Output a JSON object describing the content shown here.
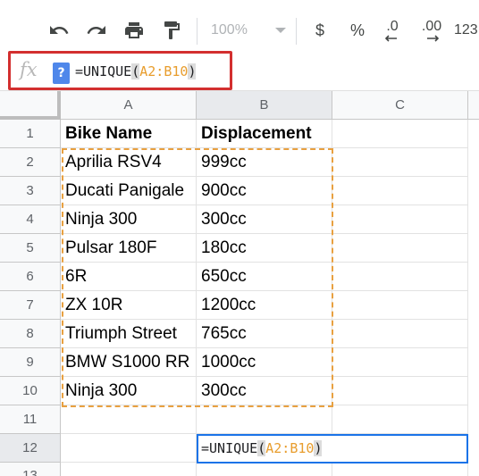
{
  "toolbar": {
    "undo_icon": "undo-icon",
    "redo_icon": "redo-icon",
    "print_icon": "print-icon",
    "paint_format_icon": "paint-format-icon",
    "zoom": "100%",
    "currency": "$",
    "percent": "%",
    "decrease_decimal": ".0",
    "increase_decimal": ".00",
    "more_formats": "123"
  },
  "formula_bar": {
    "fx_label": "fx",
    "help": "?",
    "formula_prefix": "=UNIQUE",
    "open_paren": "(",
    "range": "A2:B10",
    "close_paren": ")"
  },
  "columns": [
    "A",
    "B",
    "C"
  ],
  "rows": [
    "1",
    "2",
    "3",
    "4",
    "5",
    "6",
    "7",
    "8",
    "9",
    "10",
    "11",
    "12",
    "13"
  ],
  "cells": {
    "A1": "Bike Name",
    "B1": "Displacement",
    "A2": "Aprilia RSV4",
    "B2": "999cc",
    "A3": "Ducati Panigale",
    "B3": "900cc",
    "A4": "Ninja 300",
    "B4": "300cc",
    "A5": "Pulsar 180F",
    "B5": "180cc",
    "A6": "6R",
    "B6": "650cc",
    "A7": "ZX 10R",
    "B7": "1200cc",
    "A8": "Triumph Street",
    "B8": "765cc",
    "A9": "BMW S1000 RR",
    "B9": "1000cc",
    "A10": "Ninja 300",
    "B10": "300cc"
  },
  "active_cell": {
    "prefix": "=UNIQUE",
    "open_paren": "(",
    "range": "A2:B10",
    "close_paren": ")"
  },
  "colors": {
    "range_highlight": "#e8a040",
    "active_border": "#1a73e8",
    "callout_border": "#d32f2f"
  }
}
